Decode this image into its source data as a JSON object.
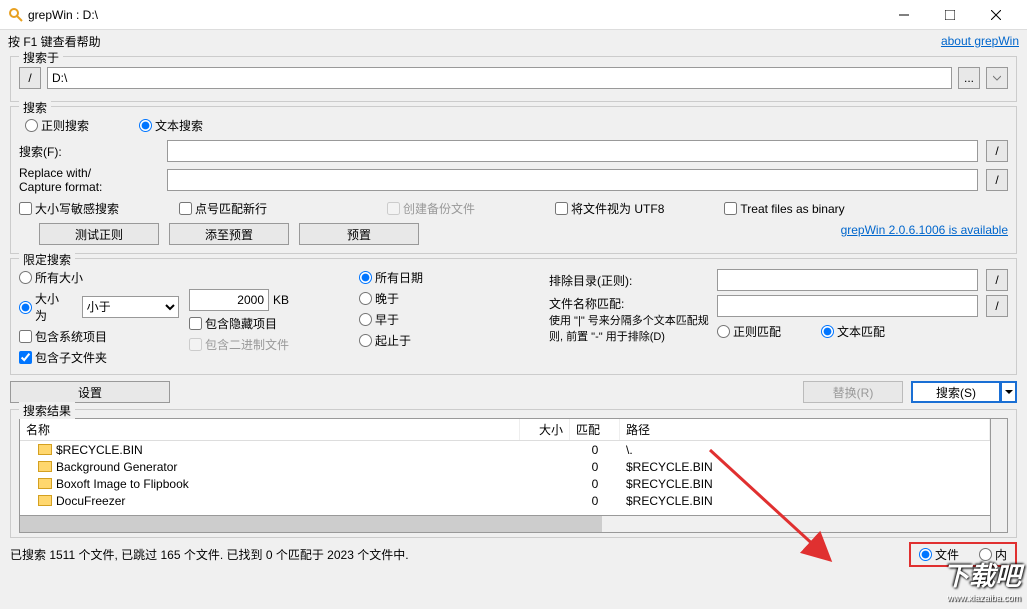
{
  "title": "grepWin : D:\\",
  "help_text": "按 F1 键查看帮助",
  "about_link": "about grepWin",
  "search_in_group": "搜索于",
  "search_path": "D:\\",
  "browse_btn": "...",
  "search_group": "搜索",
  "regex_search": "正则搜索",
  "text_search": "文本搜索",
  "search_for_label": "搜索(F):",
  "replace_with_label": "Replace with/\nCapture format:",
  "case_sensitive": "大小写敏感搜索",
  "dot_newline": "点号匹配新行",
  "create_backup": "创建备份文件",
  "treat_utf8": "将文件视为 UTF8",
  "treat_binary": "Treat files as binary",
  "test_regex": "测试正则",
  "add_preset": "添至预置",
  "presets": "预置",
  "update_link": "grepWin 2.0.6.1006 is available",
  "limit_group": "限定搜索",
  "all_sizes": "所有大小",
  "size_is": "大小为",
  "size_cmp": "小于",
  "size_val": "2000",
  "size_unit": "KB",
  "include_system": "包含系统项目",
  "include_hidden": "包含隐藏项目",
  "include_subfolders": "包含子文件夹",
  "include_binary": "包含二进制文件",
  "all_dates": "所有日期",
  "later_than": "晚于",
  "earlier_than": "早于",
  "between": "起止于",
  "exclude_dirs_label": "排除目录(正则):",
  "filename_match_label": "文件名称匹配:",
  "filename_hint": "使用 \"|\" 号来分隔多个文本匹配规则, 前置 \"-\" 用于排除(D)",
  "regex_match": "正则匹配",
  "text_match": "文本匹配",
  "settings_btn": "设置",
  "replace_btn": "替换(R)",
  "search_btn": "搜索(S)",
  "results_group": "搜索结果",
  "col_name": "名称",
  "col_size": "大小",
  "col_match": "匹配",
  "col_path": "路径",
  "rows": [
    {
      "name": "$RECYCLE.BIN",
      "size": "",
      "match": "0",
      "path": "\\."
    },
    {
      "name": "Background Generator",
      "size": "",
      "match": "0",
      "path": "$RECYCLE.BIN"
    },
    {
      "name": "Boxoft Image to Flipbook",
      "size": "",
      "match": "0",
      "path": "$RECYCLE.BIN"
    },
    {
      "name": "DocuFreezer",
      "size": "",
      "match": "0",
      "path": "$RECYCLE.BIN"
    }
  ],
  "status_text": "已搜索 1511 个文件, 已跳过 165 个文件. 已找到 0 个匹配于 2023 个文件中.",
  "files_radio": "文件",
  "content_radio": "内",
  "watermark": "下载吧",
  "watermark_url": "www.xiazaiba.com"
}
